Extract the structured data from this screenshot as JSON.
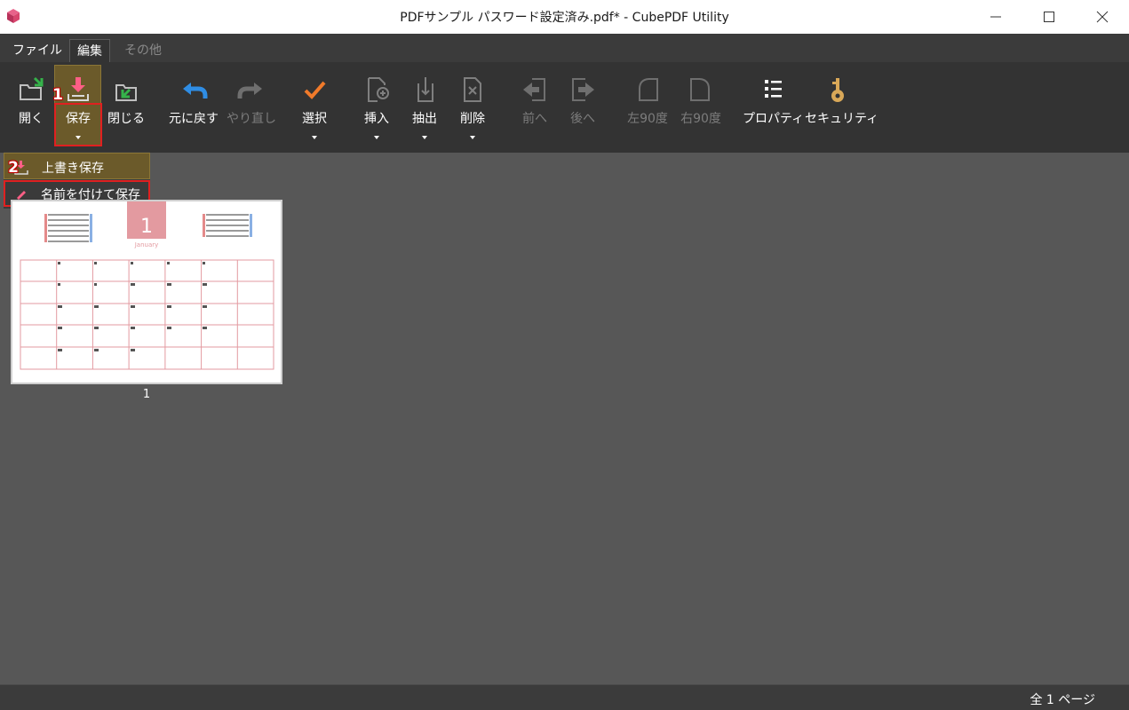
{
  "window": {
    "title": "PDFサンプル パスワード設定済み.pdf* - CubePDF Utility",
    "app_icon": "cubepdf-logo-icon",
    "controls": [
      "minimize-icon",
      "maximize-icon",
      "close-icon"
    ]
  },
  "menu_tabs": [
    {
      "label": "ファイル",
      "state": "normal"
    },
    {
      "label": "編集",
      "state": "active"
    },
    {
      "label": "その他",
      "state": "disabled"
    }
  ],
  "toolbar": {
    "open": {
      "label": "開く",
      "icon": "folder-open-icon"
    },
    "save": {
      "label": "保存",
      "icon": "save-icon",
      "has_dropdown": true,
      "state": "pressed"
    },
    "close": {
      "label": "閉じる",
      "icon": "close-file-icon"
    },
    "undo": {
      "label": "元に戻す",
      "icon": "undo-icon"
    },
    "redo": {
      "label": "やり直し",
      "icon": "redo-icon",
      "state": "disabled"
    },
    "select": {
      "label": "選択",
      "icon": "checkmark-icon",
      "has_dropdown": true
    },
    "insert": {
      "label": "挿入",
      "icon": "insert-page-icon",
      "has_dropdown": true
    },
    "extract": {
      "label": "抽出",
      "icon": "extract-icon",
      "has_dropdown": true
    },
    "delete": {
      "label": "削除",
      "icon": "delete-page-icon",
      "has_dropdown": true
    },
    "previous": {
      "label": "前へ",
      "icon": "move-previous-icon",
      "state": "disabled"
    },
    "next": {
      "label": "後へ",
      "icon": "move-next-icon",
      "state": "disabled"
    },
    "rotate_left": {
      "label": "左90度",
      "icon": "rotate-left-icon",
      "state": "disabled"
    },
    "rotate_right": {
      "label": "右90度",
      "icon": "rotate-right-icon",
      "state": "disabled"
    },
    "properties": {
      "label": "プロパティ",
      "icon": "properties-list-icon"
    },
    "security": {
      "label": "セキュリティ",
      "icon": "key-icon"
    }
  },
  "save_menu": {
    "overwrite": {
      "label": "上書き保存",
      "icon": "save-small-icon"
    },
    "save_as": {
      "label": "名前を付けて保存",
      "icon": "pen-icon"
    }
  },
  "annotations": {
    "step1": "1",
    "step2": "2"
  },
  "pages": [
    {
      "number": "1",
      "thumbnail": "calendar-page-thumbnail",
      "calendar_month": "1",
      "calendar_month_name": "January"
    }
  ],
  "status": {
    "page_count": "全 1 ページ"
  },
  "colors": {
    "window_bg": "#575757",
    "ribbon_bg": "#333333",
    "highlight": "#6b5a2a",
    "annotation_red": "#e02020"
  }
}
